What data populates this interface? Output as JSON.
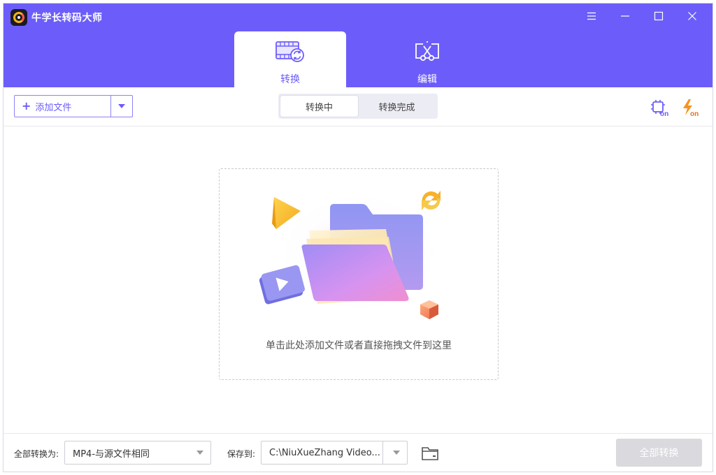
{
  "app": {
    "title": "牛学长转码大师"
  },
  "window_controls": {
    "menu_icon": "menu-icon",
    "minimize_icon": "minimize-icon",
    "maximize_icon": "maximize-icon",
    "close_icon": "close-icon"
  },
  "tabs": [
    {
      "label": "转换",
      "icon": "film-convert-icon",
      "active": true
    },
    {
      "label": "编辑",
      "icon": "scissors-frame-icon",
      "active": false
    }
  ],
  "toolbar": {
    "add_file_label": "添加文件",
    "segments": [
      {
        "label": "转换中",
        "active": true
      },
      {
        "label": "转换完成",
        "active": false
      }
    ],
    "hardware_accel_icon": "chip-on-icon",
    "fast_convert_icon": "lightning-on-icon"
  },
  "dropzone": {
    "hint": "单击此处添加文件或者直接拖拽文件到这里"
  },
  "footer": {
    "convert_to_label": "全部转换为:",
    "convert_to_value": "MP4-与源文件相同",
    "save_to_label": "保存到:",
    "save_to_value": "C:\\NiuXueZhang Video...",
    "convert_all_label": "全部转换"
  },
  "colors": {
    "brand": "#6c5dfa",
    "disabled_button": "#d9d9de",
    "accent_orange": "#f7931e"
  }
}
